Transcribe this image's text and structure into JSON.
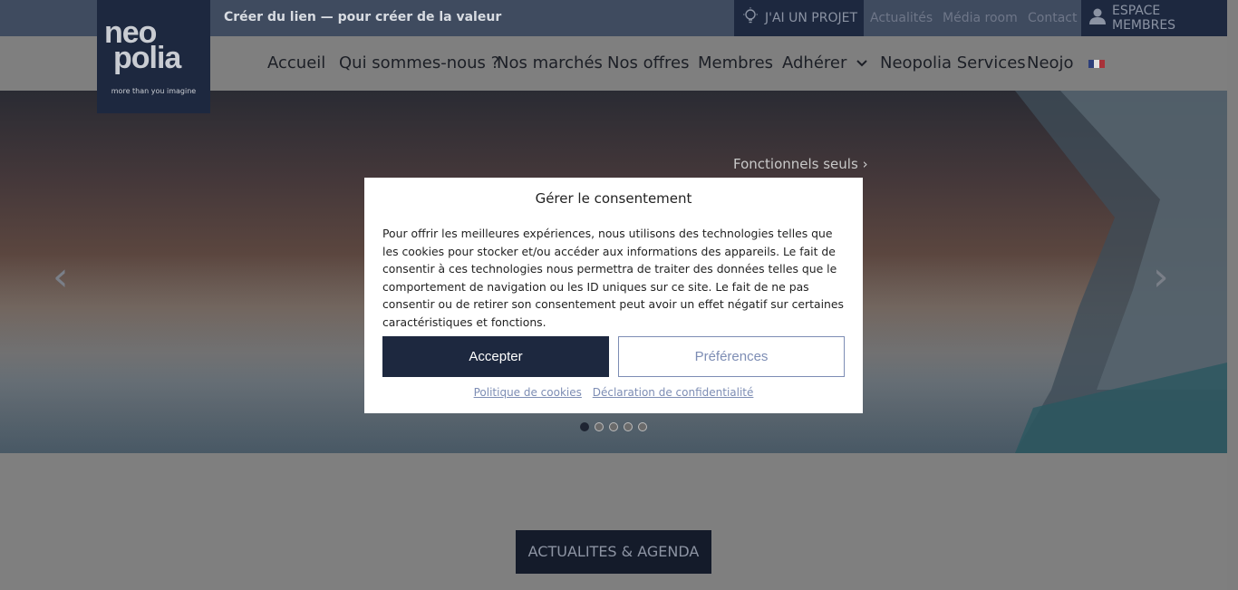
{
  "topbar": {
    "tagline": "Créer du lien — pour créer de la valeur",
    "projet": "J'AI UN PROJET",
    "links": [
      "Actualités",
      "Média room",
      "Contact"
    ],
    "members": "ESPACE MEMBRES"
  },
  "logo": {
    "line1": "neo",
    "line2": "polia",
    "tagline": "more than you imagine"
  },
  "nav": {
    "items": [
      "Accueil",
      "Qui sommes-nous ?",
      "Nos marchés",
      "Nos offres",
      "Membres",
      "Adhérer",
      "Neopolia Services",
      "Neojo"
    ],
    "language": "FR"
  },
  "hero": {
    "functional_link": "Fonctionnels seuls",
    "slides": 5,
    "active_slide": 1
  },
  "consent": {
    "title": "Gérer le consentement",
    "body": "Pour offrir les meilleures expériences, nous utilisons des technologies telles que les cookies pour stocker et/ou accéder aux informations des appareils. Le fait de consentir à ces technologies nous permettra de traiter des données telles que le comportement de navigation ou les ID uniques sur ce site. Le fait de ne pas consentir ou de retirer son consentement peut avoir un effet négatif sur certaines caractéristiques et fonctions.",
    "accept": "Accepter",
    "preferences": "Préférences",
    "cookie_policy": "Politique de cookies",
    "privacy": "Déclaration de confidentialité"
  },
  "section": {
    "button": "ACTUALITES & AGENDA"
  },
  "colors": {
    "navy": "#1d283f",
    "accent": "#7d8db4"
  }
}
